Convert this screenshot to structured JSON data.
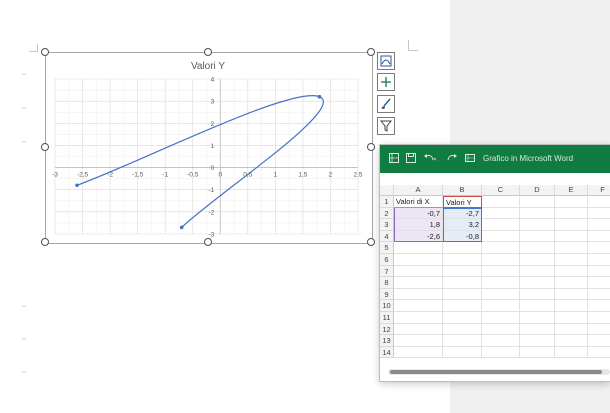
{
  "excel_window": {
    "title": "Grafico in Microsoft Word",
    "columns": [
      "A",
      "B",
      "C",
      "D",
      "E",
      "F"
    ],
    "rows": [
      "1",
      "2",
      "3",
      "4",
      "5",
      "6",
      "7",
      "8",
      "9",
      "10",
      "11",
      "12",
      "13",
      "14"
    ],
    "headers": [
      "Valori di X",
      "Valori Y"
    ],
    "data": [
      [
        "-0,7",
        "-2,7"
      ],
      [
        "1,8",
        "3,2"
      ],
      [
        "-2,6",
        "-0,8"
      ]
    ]
  },
  "chart_data": {
    "type": "scatter",
    "title": "Valori Y",
    "points": [
      {
        "x": -0.7,
        "y": -2.7
      },
      {
        "x": 1.8,
        "y": 3.2
      },
      {
        "x": -2.6,
        "y": -0.8
      }
    ],
    "x_ticks": [
      "-3",
      "-2,5",
      "-2",
      "-1,5",
      "-1",
      "-0,5",
      "0",
      "0,5",
      "1",
      "1,5",
      "2",
      "2,5"
    ],
    "y_ticks": [
      "4",
      "3",
      "2",
      "1",
      "0",
      "-1",
      "-2",
      "-3"
    ],
    "xlim": [
      -3,
      2.5
    ],
    "ylim": [
      -3,
      4
    ],
    "smooth_lines": true,
    "grid": true,
    "series_color": "#4472c4"
  }
}
